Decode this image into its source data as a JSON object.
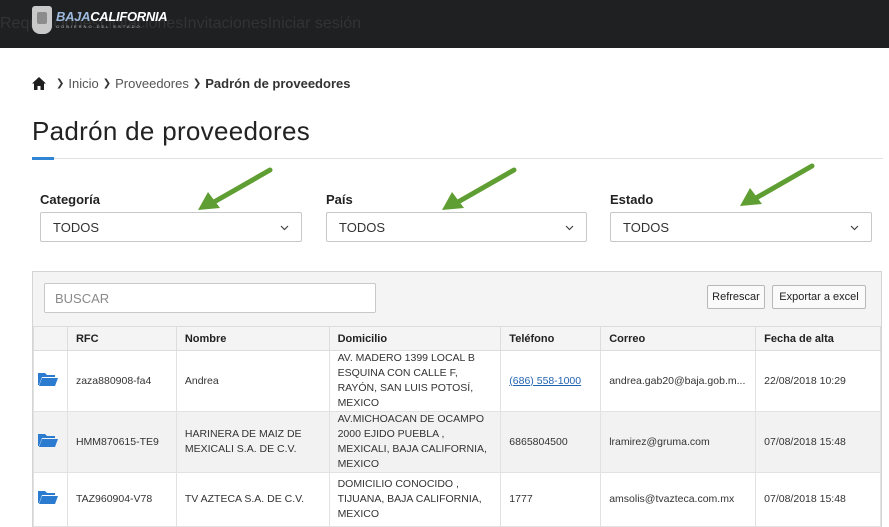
{
  "header": {
    "logo_text_a": "BAJA",
    "logo_text_b": "CALIFORNIA",
    "logo_sub": "GOBIERNO DEL ESTADO",
    "nav": [
      "Requisiciones",
      "Licitaciones",
      "Invitaciones",
      "Iniciar sesión"
    ]
  },
  "breadcrumb": {
    "items": [
      "Inicio",
      "Proveedores",
      "Padrón de proveedores"
    ]
  },
  "page": {
    "title": "Padrón de proveedores"
  },
  "filters": {
    "categoria": {
      "label": "Categoría",
      "value": "TODOS"
    },
    "pais": {
      "label": "País",
      "value": "TODOS"
    },
    "estado": {
      "label": "Estado",
      "value": "TODOS"
    }
  },
  "toolbar": {
    "search_placeholder": "BUSCAR",
    "refresh_label": "Refrescar",
    "export_label": "Exportar a excel"
  },
  "table": {
    "headers": [
      "RFC",
      "Nombre",
      "Domicilio",
      "Teléfono",
      "Correo",
      "Fecha de alta"
    ],
    "rows": [
      {
        "rfc": "zaza880908-fa4",
        "nombre": "Andrea",
        "domicilio": "AV. MADERO 1399 LOCAL B ESQUINA CON CALLE F, RAYÓN, SAN LUIS POTOSÍ, MEXICO",
        "telefono": "(686) 558-1000",
        "correo": "andrea.gab20@baja.gob.m...",
        "fecha": "22/08/2018 10:29"
      },
      {
        "rfc": "HMM870615-TE9",
        "nombre": "HARINERA DE MAIZ DE MEXICALI S.A. DE C.V.",
        "domicilio": "AV.MICHOACAN DE OCAMPO 2000 EJIDO PUEBLA , MEXICALI, BAJA CALIFORNIA, MEXICO",
        "telefono": "6865804500",
        "correo": "lramirez@gruma.com",
        "fecha": "07/08/2018 15:48"
      },
      {
        "rfc": "TAZ960904-V78",
        "nombre": "TV AZTECA S.A. DE C.V.",
        "domicilio": "DOMICILIO CONOCIDO , TIJUANA, BAJA CALIFORNIA, MEXICO",
        "telefono": "1777",
        "correo": "amsolis@tvazteca.com.mx",
        "fecha": "07/08/2018 15:48"
      }
    ]
  },
  "colors": {
    "topbar": "#1e2022",
    "accent": "#2f84d3",
    "annotation_arrow": "#5f9e32",
    "folder_icon": "#2b7bd0"
  }
}
